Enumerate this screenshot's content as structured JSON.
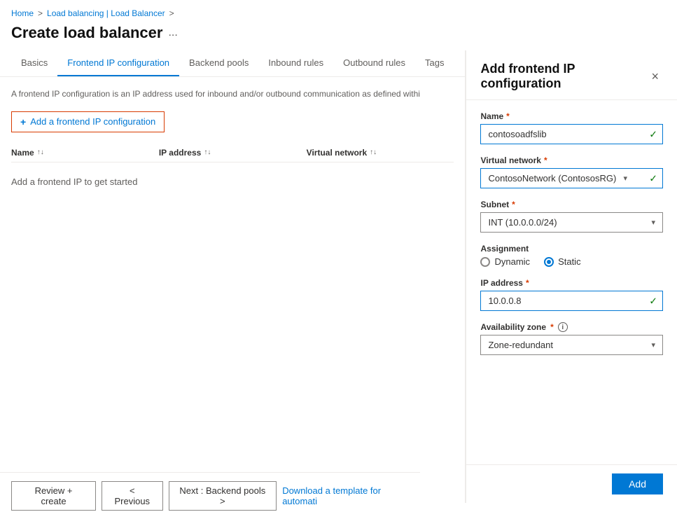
{
  "breadcrumb": {
    "home": "Home",
    "separator1": ">",
    "loadBalancing": "Load balancing | Load Balancer",
    "separator2": ">"
  },
  "pageTitle": "Create load balancer",
  "moreOptions": "...",
  "tabs": [
    {
      "id": "basics",
      "label": "Basics",
      "active": false
    },
    {
      "id": "frontend-ip",
      "label": "Frontend IP configuration",
      "active": true
    },
    {
      "id": "backend-pools",
      "label": "Backend pools",
      "active": false
    },
    {
      "id": "inbound-rules",
      "label": "Inbound rules",
      "active": false
    },
    {
      "id": "outbound-rules",
      "label": "Outbound rules",
      "active": false
    },
    {
      "id": "tags",
      "label": "Tags",
      "active": false
    }
  ],
  "description": "A frontend IP configuration is an IP address used for inbound and/or outbound communication as defined withi",
  "addButton": "+ Add a frontend IP configuration",
  "table": {
    "columns": [
      {
        "label": "Name"
      },
      {
        "label": "IP address"
      },
      {
        "label": "Virtual network"
      }
    ],
    "emptyText": "Add a frontend IP to get started"
  },
  "bottomBar": {
    "reviewCreate": "Review + create",
    "previous": "< Previous",
    "next": "Next : Backend pools >",
    "downloadLink": "Download a template for automati"
  },
  "rightPanel": {
    "title": "Add frontend IP configuration",
    "closeLabel": "×",
    "form": {
      "nameLabel": "Name",
      "nameRequired": "*",
      "nameValue": "contosoadfslib",
      "virtualNetworkLabel": "Virtual network",
      "virtualNetworkRequired": "*",
      "virtualNetworkValue": "ContosoNetwork (ContososRG)",
      "subnetLabel": "Subnet",
      "subnetRequired": "*",
      "subnetValue": "INT (10.0.0.0/24)",
      "assignmentLabel": "Assignment",
      "dynamicLabel": "Dynamic",
      "staticLabel": "Static",
      "ipAddressLabel": "IP address",
      "ipAddressRequired": "*",
      "ipAddressValue": "10.0.0.8",
      "availabilityZoneLabel": "Availability zone",
      "availabilityZoneRequired": "*",
      "availabilityZoneValue": "Zone-redundant"
    },
    "addButton": "Add"
  }
}
